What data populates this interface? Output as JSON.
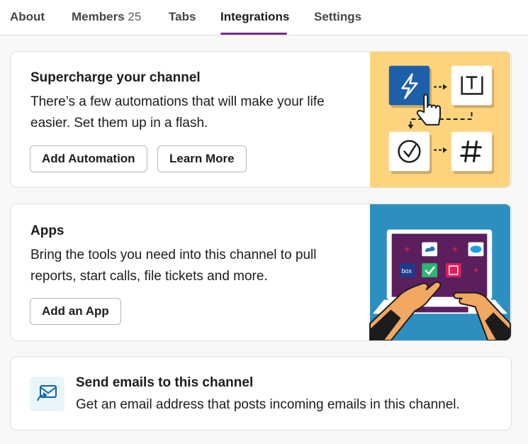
{
  "tabs": {
    "about": "About",
    "members": "Members",
    "members_count": "25",
    "tabs": "Tabs",
    "integrations": "Integrations",
    "settings": "Settings"
  },
  "automation_card": {
    "title": "Supercharge your channel",
    "description": "There’s a few automations that will make your life easier. Set them up in a flash.",
    "add_button": "Add Automation",
    "learn_button": "Learn More",
    "bg_color": "#fdd47d"
  },
  "apps_card": {
    "title": "Apps",
    "description": "Bring the tools you need into this channel to pull reports, start calls, file tickets and more.",
    "add_button": "Add an App",
    "bg_color": "#2d8fbf"
  },
  "email_card": {
    "title": "Send emails to this channel",
    "description": "Get an email address that posts incoming emails in this channel."
  },
  "colors": {
    "accent": "#7b2c8b",
    "icon_blue": "#1264a3"
  },
  "icons": [
    "lightning-icon",
    "text-icon",
    "check-circle-icon",
    "hash-icon",
    "pointer-hand-icon",
    "email-forward-icon"
  ]
}
